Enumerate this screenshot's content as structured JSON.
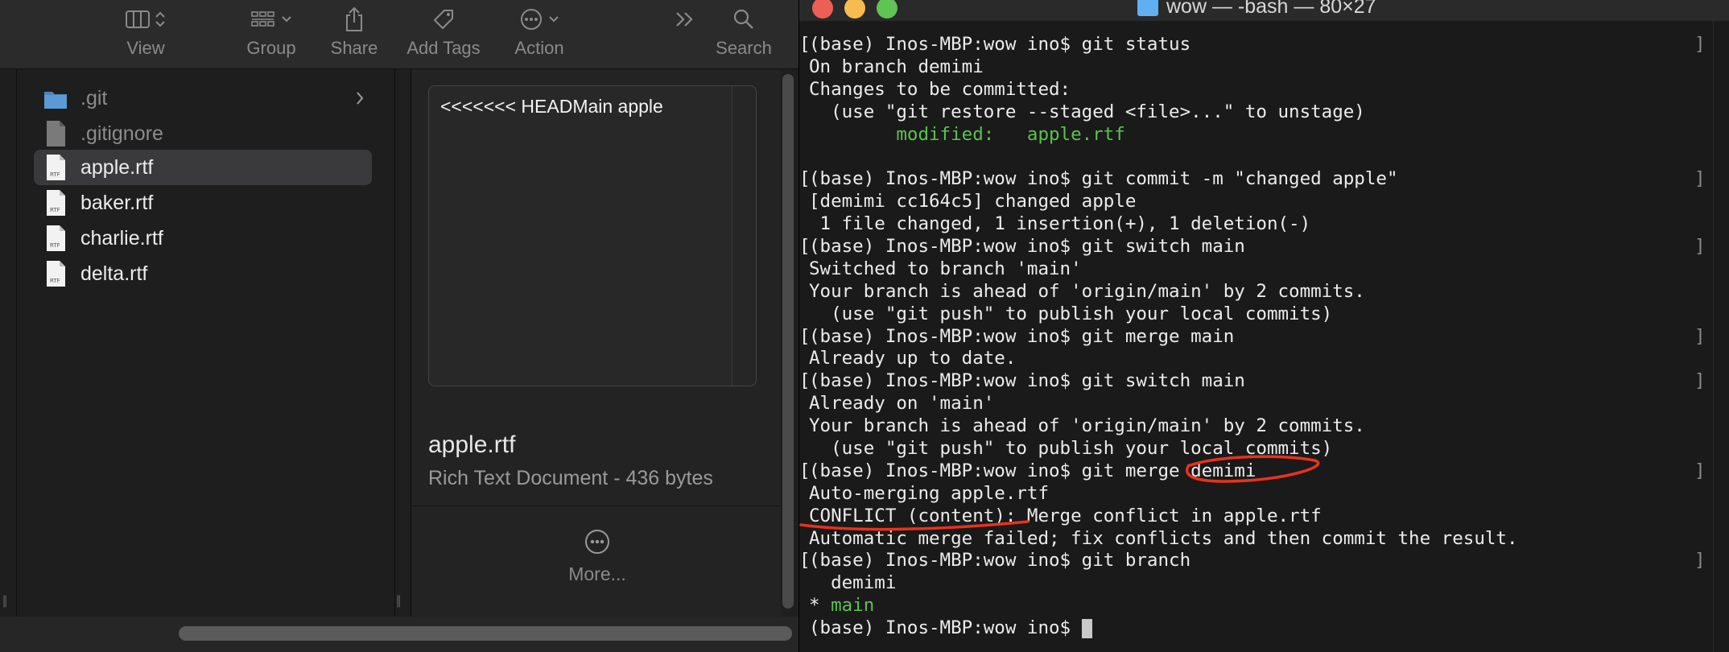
{
  "finder": {
    "toolbar": {
      "view": "View",
      "group": "Group",
      "share": "Share",
      "add_tags": "Add Tags",
      "action": "Action",
      "search": "Search"
    },
    "files": [
      {
        "name": ".git",
        "type": "folder"
      },
      {
        "name": ".gitignore",
        "type": "file"
      },
      {
        "name": "apple.rtf",
        "type": "rtf",
        "selected": true
      },
      {
        "name": "baker.rtf",
        "type": "rtf"
      },
      {
        "name": "charlie.rtf",
        "type": "rtf"
      },
      {
        "name": "delta.rtf",
        "type": "rtf"
      }
    ],
    "file_icon_label": "RTF",
    "preview": {
      "content": "<<<<<<< HEADMain apple",
      "title": "apple.rtf",
      "subtitle": "Rich Text Document - 436 bytes",
      "more": "More..."
    }
  },
  "terminal": {
    "title": "wow — -bash — 80×27",
    "lines": [
      {
        "text": "(base) Inos-MBP:wow ino$ git status",
        "prompt": true
      },
      {
        "text": "On branch demimi"
      },
      {
        "text": "Changes to be committed:"
      },
      {
        "text": "  (use \"git restore --staged <file>...\" to unstage)"
      },
      {
        "text": "        modified:   apple.rtf",
        "color": "green"
      },
      {
        "text": ""
      },
      {
        "text": "(base) Inos-MBP:wow ino$ git commit -m \"changed apple\"",
        "prompt": true
      },
      {
        "text": "[demimi cc164c5] changed apple"
      },
      {
        "text": " 1 file changed, 1 insertion(+), 1 deletion(-)"
      },
      {
        "text": "(base) Inos-MBP:wow ino$ git switch main",
        "prompt": true
      },
      {
        "text": "Switched to branch 'main'"
      },
      {
        "text": "Your branch is ahead of 'origin/main' by 2 commits."
      },
      {
        "text": "  (use \"git push\" to publish your local commits)"
      },
      {
        "text": "(base) Inos-MBP:wow ino$ git merge main",
        "prompt": true
      },
      {
        "text": "Already up to date."
      },
      {
        "text": "(base) Inos-MBP:wow ino$ git switch main",
        "prompt": true
      },
      {
        "text": "Already on 'main'"
      },
      {
        "text": "Your branch is ahead of 'origin/main' by 2 commits."
      },
      {
        "text": "  (use \"git push\" to publish your local commits)"
      },
      {
        "text": "(base) Inos-MBP:wow ino$ git merge demimi",
        "prompt": true
      },
      {
        "text": "Auto-merging apple.rtf"
      },
      {
        "text": "CONFLICT (content): Merge conflict in apple.rtf"
      },
      {
        "text": "Automatic merge failed; fix conflicts and then commit the result."
      },
      {
        "text": "(base) Inos-MBP:wow ino$ git branch",
        "prompt": true
      },
      {
        "text": "  demimi"
      },
      {
        "text": "* main",
        "color": "green_partial"
      },
      {
        "text": "(base) Inos-MBP:wow ino$ ",
        "prompt": true,
        "cursor": true
      }
    ],
    "colors": {
      "background": "#1a1a1a",
      "foreground": "#ececec",
      "green": "#5bc24e",
      "annotation": "#e8321e"
    }
  }
}
